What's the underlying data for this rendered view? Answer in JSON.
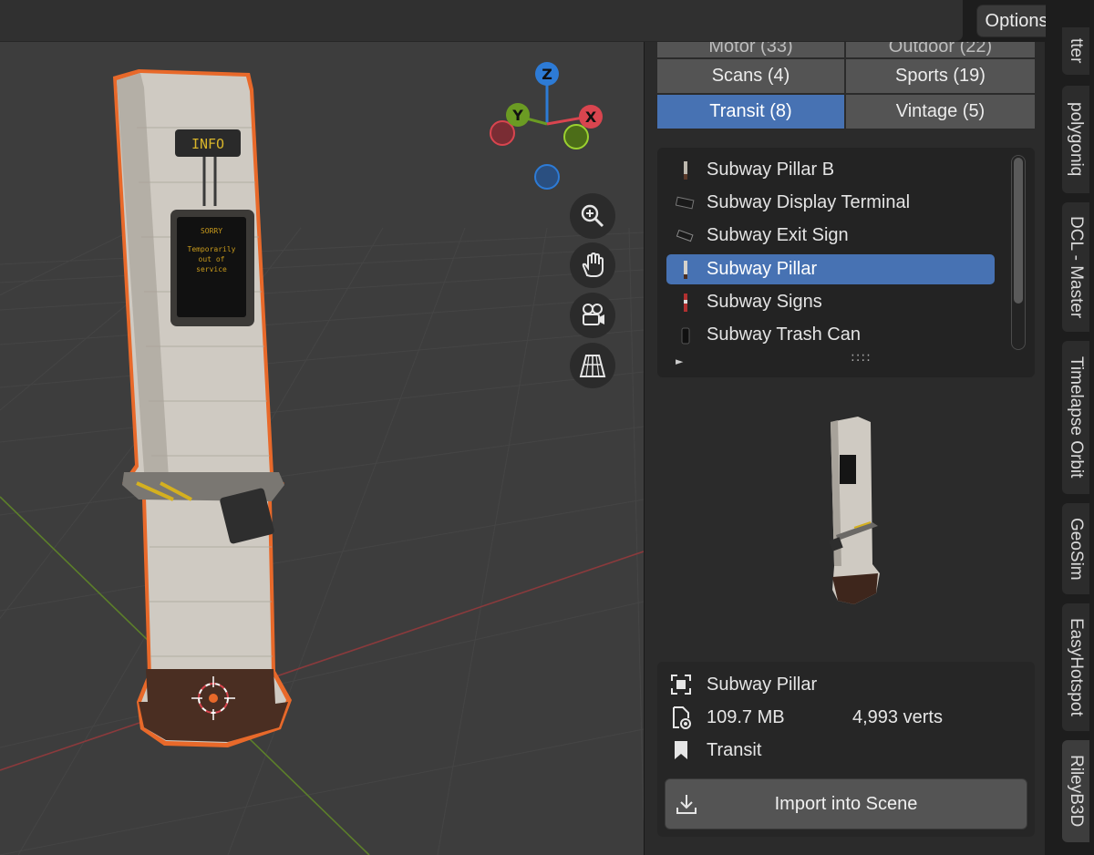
{
  "header": {
    "options_label": "Options"
  },
  "viewport": {
    "gizmo": {
      "z": "Z",
      "y": "Y",
      "x": "X"
    },
    "model_screen": {
      "sign": "INFO",
      "line1": "SORRY",
      "line2": "Temporarily",
      "line3": "out of",
      "line4": "service"
    }
  },
  "categories": [
    {
      "label": "Motor  (33)",
      "partial": true
    },
    {
      "label": "Outdoor  (22)",
      "partial": true
    },
    {
      "label": "Scans  (4)"
    },
    {
      "label": "Sports  (19)"
    },
    {
      "label": "Transit  (8)",
      "active": true
    },
    {
      "label": "Vintage  (5)"
    }
  ],
  "assets": [
    {
      "label": "Subway Pillar B",
      "icon": "pillar-b-thumb-icon"
    },
    {
      "label": "Subway Display Terminal",
      "icon": "terminal-thumb-icon"
    },
    {
      "label": "Subway Exit Sign",
      "icon": "exit-sign-thumb-icon"
    },
    {
      "label": "Subway Pillar",
      "icon": "pillar-thumb-icon",
      "selected": true
    },
    {
      "label": "Subway Signs",
      "icon": "signs-thumb-icon"
    },
    {
      "label": "Subway Trash Can",
      "icon": "trash-can-thumb-icon"
    }
  ],
  "list_footer": {
    "expand": "►",
    "grip": "::::"
  },
  "info": {
    "name": "Subway Pillar",
    "size": "109.7 MB",
    "verts": "4,993 verts",
    "category": "Transit",
    "import_label": "Import into Scene"
  },
  "tabs": [
    {
      "label": "tter"
    },
    {
      "label": "polygoniq"
    },
    {
      "label": "DCL - Master"
    },
    {
      "label": "Timelapse Orbit"
    },
    {
      "label": "GeoSim"
    },
    {
      "label": "EasyHotspot"
    },
    {
      "label": "RileyB3D",
      "active": true
    }
  ],
  "colors": {
    "accent": "#4772b3",
    "selection_outline": "#e8692a",
    "axis_x": "#d9454f",
    "axis_y": "#6b9b23",
    "axis_z": "#2d7bd6"
  }
}
